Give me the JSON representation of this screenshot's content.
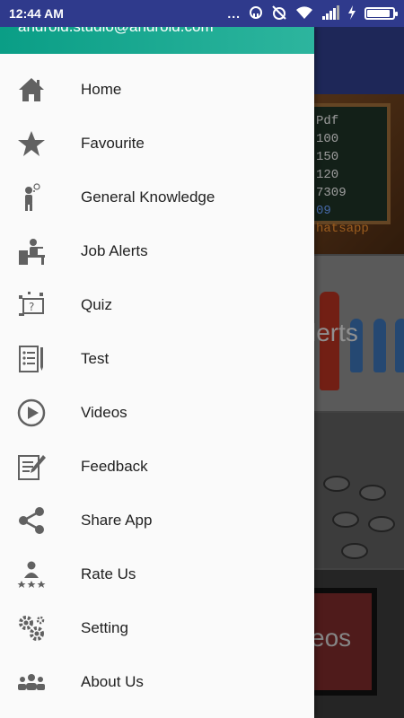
{
  "status_bar": {
    "time": "12:44 AM",
    "dots": "...",
    "battery_level": 0.9
  },
  "drawer": {
    "email": "android.studio@android.com",
    "items": [
      {
        "label": "Home",
        "icon": "home-icon"
      },
      {
        "label": "Favourite",
        "icon": "star-icon"
      },
      {
        "label": "General Knowledge",
        "icon": "thinking-person-icon"
      },
      {
        "label": "Job Alerts",
        "icon": "desk-worker-icon"
      },
      {
        "label": "Quiz",
        "icon": "quiz-icon"
      },
      {
        "label": "Test",
        "icon": "test-sheet-icon"
      },
      {
        "label": "Videos",
        "icon": "play-circle-icon"
      },
      {
        "label": "Feedback",
        "icon": "feedback-icon"
      },
      {
        "label": "Share App",
        "icon": "share-icon"
      },
      {
        "label": "Rate Us",
        "icon": "rate-icon"
      },
      {
        "label": "Setting",
        "icon": "gears-icon"
      },
      {
        "label": "About Us",
        "icon": "group-icon"
      }
    ]
  },
  "background": {
    "card1_lines": [
      "Pdf",
      "100",
      "150",
      "120",
      "7309",
      "09",
      "hatsapp"
    ],
    "card2_text": "lerts",
    "card4_text": "eos"
  },
  "colors": {
    "status_bar": "#2f3a8c",
    "drawer_header": "#0a9e86",
    "icon_gray": "#616161"
  }
}
